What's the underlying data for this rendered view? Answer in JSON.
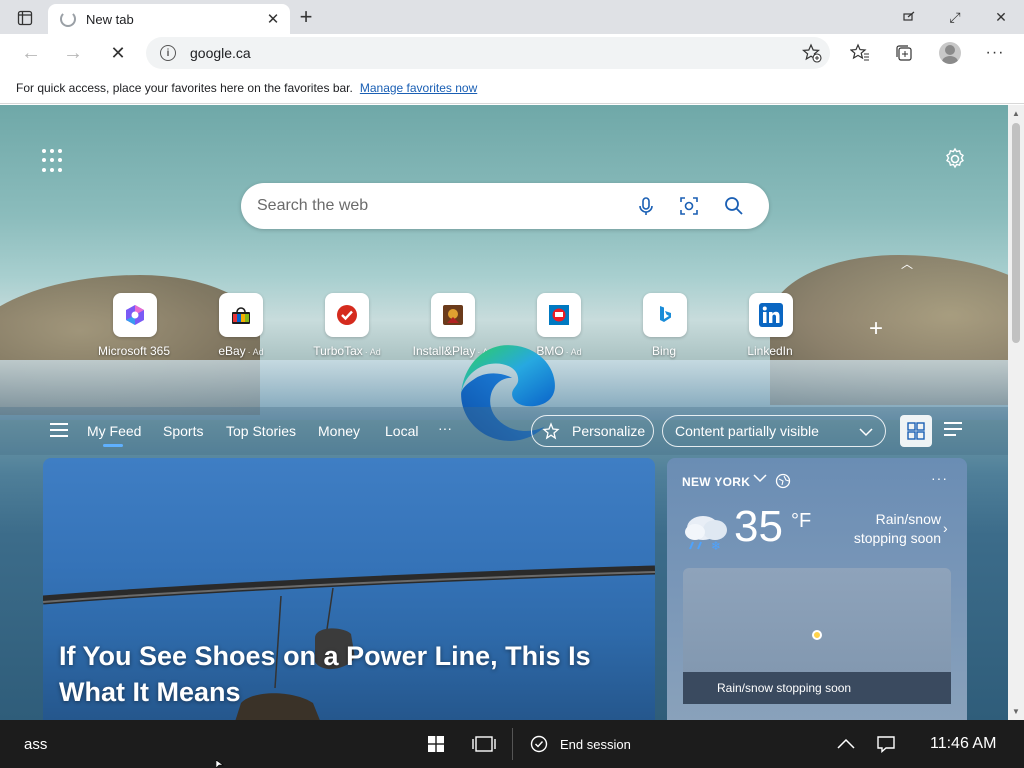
{
  "tab": {
    "title": "New tab",
    "close": "✕"
  },
  "window": {
    "restore": "⤢",
    "close": "✕"
  },
  "toolbar": {
    "url": "google.ca"
  },
  "favbar": {
    "prompt": "For quick access, place your favorites here on the favorites bar.",
    "link": "Manage favorites now"
  },
  "search": {
    "placeholder": "Search the web"
  },
  "tiles": [
    {
      "label": "Microsoft 365",
      "ad": ""
    },
    {
      "label": "eBay",
      "ad": "· Ad"
    },
    {
      "label": "TurboTax",
      "ad": "· Ad"
    },
    {
      "label": "Install&Play",
      "ad": "· Ad"
    },
    {
      "label": "BMO",
      "ad": "· Ad"
    },
    {
      "label": "Bing",
      "ad": ""
    },
    {
      "label": "LinkedIn",
      "ad": ""
    }
  ],
  "feed": {
    "tabs": [
      "My Feed",
      "Sports",
      "Top Stories",
      "Money",
      "Local"
    ],
    "more": "···",
    "personalize": "Personalize",
    "visibility": "Content partially visible"
  },
  "hero": {
    "title": "If You See Shoes on a Power Line, This Is What It Means"
  },
  "weather": {
    "location": "NEW YORK",
    "more": "···",
    "temp": "35",
    "unit": "°F",
    "condition": "Rain/snow stopping soon",
    "map_caption": "Rain/snow stopping soon"
  },
  "taskbar": {
    "text": "ass",
    "end_session": "End session",
    "clock": "11:46 AM"
  }
}
